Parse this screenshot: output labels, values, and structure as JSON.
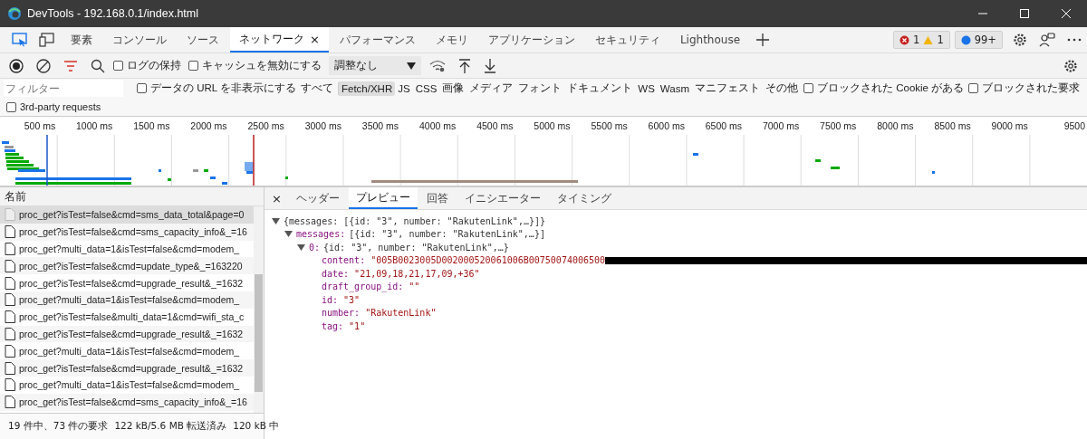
{
  "window": {
    "title": "DevTools - 192.168.0.1/index.html"
  },
  "tabs": [
    {
      "label": "要素",
      "selected": false
    },
    {
      "label": "コンソール",
      "selected": false
    },
    {
      "label": "ソース",
      "selected": false
    },
    {
      "label": "ネットワーク",
      "selected": true,
      "close": "×"
    },
    {
      "label": "パフォーマンス",
      "selected": false
    },
    {
      "label": "メモリ",
      "selected": false
    },
    {
      "label": "アプリケーション",
      "selected": false
    },
    {
      "label": "セキュリティ",
      "selected": false
    },
    {
      "label": "Lighthouse",
      "selected": false
    }
  ],
  "issues": {
    "errors": "1",
    "warnings": "1",
    "messages": "99+"
  },
  "toolbar": {
    "preserve_log": {
      "label": "ログの保持",
      "checked": false
    },
    "disable_cache": {
      "label": "キャッシュを無効にする",
      "checked": false
    },
    "throttling": "調整なし"
  },
  "filter": {
    "placeholder": "フィルター",
    "hide_data_urls": {
      "label": "データの URL を非表示にする",
      "checked": false
    },
    "types": [
      {
        "label": "すべて",
        "selected": false
      },
      {
        "label": "Fetch/XHR",
        "selected": true
      },
      {
        "label": "JS",
        "selected": false
      },
      {
        "label": "CSS",
        "selected": false
      },
      {
        "label": "画像",
        "selected": false
      },
      {
        "label": "メディア",
        "selected": false
      },
      {
        "label": "フォント",
        "selected": false
      },
      {
        "label": "ドキュメント",
        "selected": false
      },
      {
        "label": "WS",
        "selected": false
      },
      {
        "label": "Wasm",
        "selected": false
      },
      {
        "label": "マニフェスト",
        "selected": false
      },
      {
        "label": "その他",
        "selected": false
      }
    ],
    "blocked_cookies": {
      "label": "ブロックされた Cookie がある",
      "checked": false
    },
    "blocked_requests": {
      "label": "ブロックされた要求",
      "checked": false
    },
    "third_party": {
      "label": "3rd-party requests",
      "checked": false
    }
  },
  "timeline": {
    "ticks": [
      "500 ms",
      "1000 ms",
      "1500 ms",
      "2000 ms",
      "2500 ms",
      "3000 ms",
      "3500 ms",
      "4000 ms",
      "4500 ms",
      "5000 ms",
      "5500 ms",
      "6000 ms",
      "6500 ms",
      "7000 ms",
      "7500 ms",
      "8000 ms",
      "8500 ms",
      "9000 ms",
      "9500"
    ]
  },
  "requests": {
    "header": "名前",
    "rows": [
      {
        "name": "proc_get?isTest=false&cmd=sms_data_total&page=0",
        "selected": true
      },
      {
        "name": "proc_get?isTest=false&cmd=sms_capacity_info&_=16",
        "selected": false
      },
      {
        "name": "proc_get?multi_data=1&isTest=false&cmd=modem_",
        "selected": false
      },
      {
        "name": "proc_get?isTest=false&cmd=update_type&_=163220",
        "selected": false
      },
      {
        "name": "proc_get?isTest=false&cmd=upgrade_result&_=1632",
        "selected": false
      },
      {
        "name": "proc_get?multi_data=1&isTest=false&cmd=modem_",
        "selected": false
      },
      {
        "name": "proc_get?isTest=false&multi_data=1&cmd=wifi_sta_c",
        "selected": false
      },
      {
        "name": "proc_get?isTest=false&cmd=upgrade_result&_=1632",
        "selected": false
      },
      {
        "name": "proc_get?multi_data=1&isTest=false&cmd=modem_",
        "selected": false
      },
      {
        "name": "proc_get?isTest=false&cmd=upgrade_result&_=1632",
        "selected": false
      },
      {
        "name": "proc_get?multi_data=1&isTest=false&cmd=modem_",
        "selected": false
      },
      {
        "name": "proc_get?isTest=false&cmd=sms_capacity_info&_=16",
        "selected": false
      }
    ]
  },
  "status_bar": [
    "19 件中、73 件の要求",
    "122 kB/5.6 MB 転送済み",
    "120 kB 中"
  ],
  "detail": {
    "close": "×",
    "tabs": [
      {
        "label": "ヘッダー",
        "selected": false
      },
      {
        "label": "プレビュー",
        "selected": true
      },
      {
        "label": "回答",
        "selected": false
      },
      {
        "label": "イニシエーター",
        "selected": false
      },
      {
        "label": "タイミング",
        "selected": false
      }
    ],
    "preview": {
      "summary": "{messages: [{id: \"3\", number: \"RakutenLink\",…}]}",
      "expanded": true,
      "children": [
        {
          "key": "messages:",
          "value": "[{id: \"3\", number: \"RakutenLink\",…}]",
          "expanded": true,
          "children": [
            {
              "key": "0:",
              "value": "{id: \"3\", number: \"RakutenLink\",…}",
              "expanded": true,
              "children": [
                {
                  "key": "content:",
                  "value": "\"005B0023005D002000520061006B00750074006500",
                  "redacted": true
                },
                {
                  "key": "date:",
                  "value": "\"21,09,18,21,17,09,+36\""
                },
                {
                  "key": "draft_group_id:",
                  "value": "\"\""
                },
                {
                  "key": "id:",
                  "value": "\"3\""
                },
                {
                  "key": "number:",
                  "value": "\"RakutenLink\""
                },
                {
                  "key": "tag:",
                  "value": "\"1\""
                }
              ]
            }
          ]
        }
      ]
    }
  }
}
